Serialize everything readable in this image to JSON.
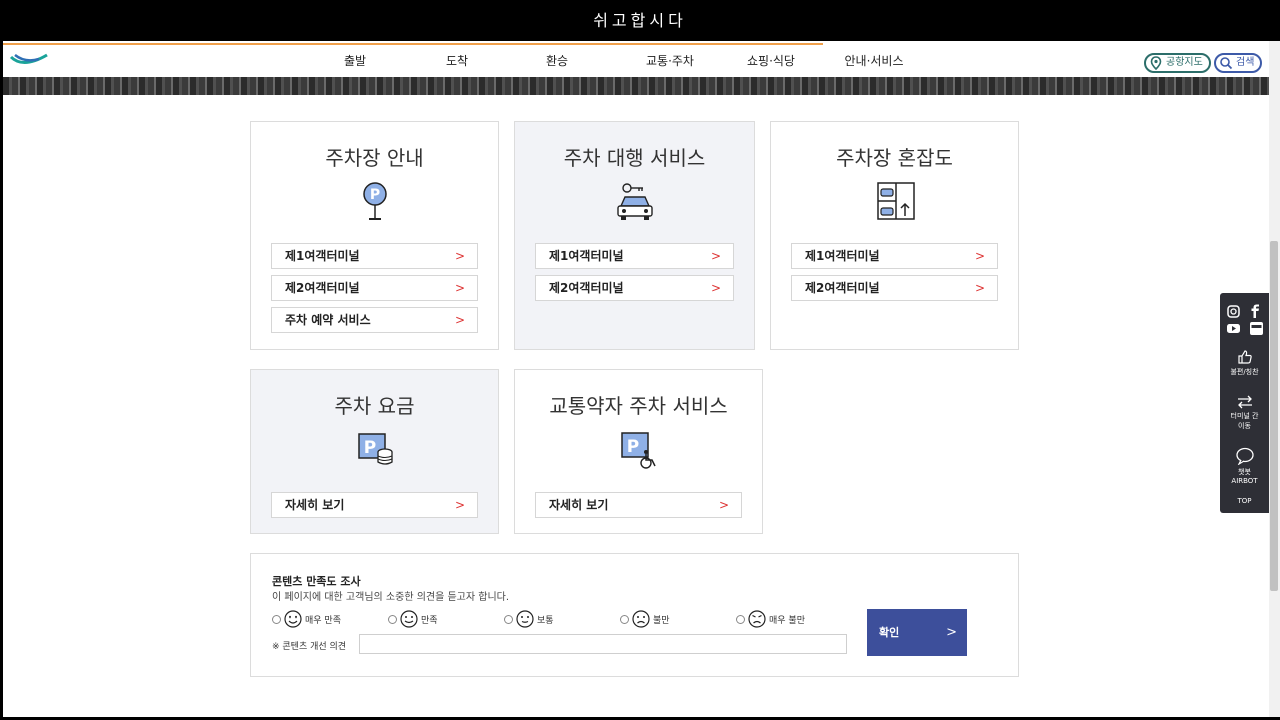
{
  "window": {
    "title": "쉬고합시다"
  },
  "header": {
    "menu": [
      "출발",
      "도착",
      "환승",
      "교통·주차",
      "쇼핑·식당",
      "안내·서비스"
    ],
    "map_label": "공항지도",
    "search_label": "검색"
  },
  "cards": {
    "parking_guide": {
      "title": "주차장 안내",
      "links": [
        "제1여객터미널",
        "제2여객터미널",
        "주차 예약 서비스"
      ]
    },
    "valet": {
      "title": "주차 대행 서비스",
      "links": [
        "제1여객터미널",
        "제2여객터미널"
      ]
    },
    "congestion": {
      "title": "주차장 혼잡도",
      "links": [
        "제1여객터미널",
        "제2여객터미널"
      ]
    },
    "fee": {
      "title": "주차 요금",
      "links": [
        "자세히 보기"
      ]
    },
    "accessible": {
      "title": "교통약자 주차 서비스",
      "links": [
        "자세히 보기"
      ]
    },
    "arrow": ">"
  },
  "survey": {
    "title": "콘텐츠 만족도 조사",
    "subtitle": "이 페이지에 대한 고객님의 소중한 의견을 듣고자 합니다.",
    "options": [
      "매우 만족",
      "만족",
      "보통",
      "불만",
      "매우 불만"
    ],
    "opinion_label": "※ 콘텐츠 개선 의견",
    "submit_label": "확인",
    "submit_arrow": ">"
  },
  "quick_menu": {
    "complaint": "불편/칭찬",
    "terminal_move_1": "터미널 간",
    "terminal_move_2": "이동",
    "chatbot_1": "챗봇",
    "chatbot_2": "AIRBOT",
    "top": "TOP"
  },
  "colors": {
    "accent": "#3d4f9b",
    "arrow": "#dd3333",
    "progress": "#f0a04b"
  }
}
